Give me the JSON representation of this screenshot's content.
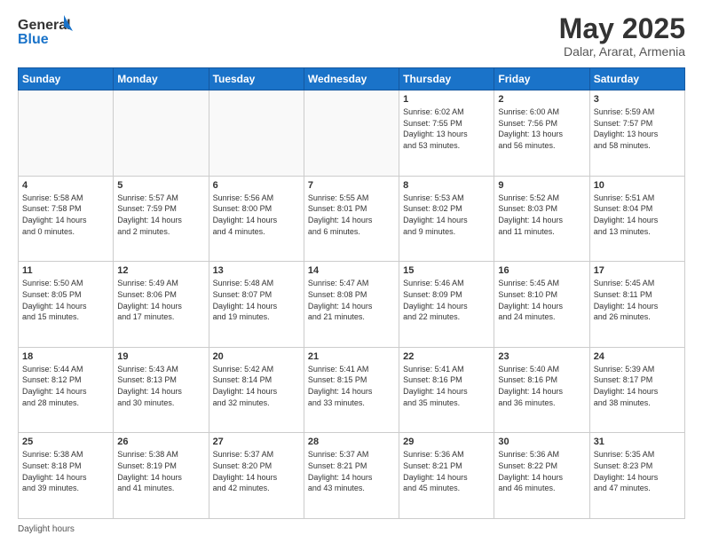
{
  "logo": {
    "line1": "General",
    "line2": "Blue"
  },
  "title": "May 2025",
  "subtitle": "Dalar, Ararat, Armenia",
  "days_header": [
    "Sunday",
    "Monday",
    "Tuesday",
    "Wednesday",
    "Thursday",
    "Friday",
    "Saturday"
  ],
  "weeks": [
    [
      {
        "day": "",
        "info": ""
      },
      {
        "day": "",
        "info": ""
      },
      {
        "day": "",
        "info": ""
      },
      {
        "day": "",
        "info": ""
      },
      {
        "day": "1",
        "info": "Sunrise: 6:02 AM\nSunset: 7:55 PM\nDaylight: 13 hours\nand 53 minutes."
      },
      {
        "day": "2",
        "info": "Sunrise: 6:00 AM\nSunset: 7:56 PM\nDaylight: 13 hours\nand 56 minutes."
      },
      {
        "day": "3",
        "info": "Sunrise: 5:59 AM\nSunset: 7:57 PM\nDaylight: 13 hours\nand 58 minutes."
      }
    ],
    [
      {
        "day": "4",
        "info": "Sunrise: 5:58 AM\nSunset: 7:58 PM\nDaylight: 14 hours\nand 0 minutes."
      },
      {
        "day": "5",
        "info": "Sunrise: 5:57 AM\nSunset: 7:59 PM\nDaylight: 14 hours\nand 2 minutes."
      },
      {
        "day": "6",
        "info": "Sunrise: 5:56 AM\nSunset: 8:00 PM\nDaylight: 14 hours\nand 4 minutes."
      },
      {
        "day": "7",
        "info": "Sunrise: 5:55 AM\nSunset: 8:01 PM\nDaylight: 14 hours\nand 6 minutes."
      },
      {
        "day": "8",
        "info": "Sunrise: 5:53 AM\nSunset: 8:02 PM\nDaylight: 14 hours\nand 9 minutes."
      },
      {
        "day": "9",
        "info": "Sunrise: 5:52 AM\nSunset: 8:03 PM\nDaylight: 14 hours\nand 11 minutes."
      },
      {
        "day": "10",
        "info": "Sunrise: 5:51 AM\nSunset: 8:04 PM\nDaylight: 14 hours\nand 13 minutes."
      }
    ],
    [
      {
        "day": "11",
        "info": "Sunrise: 5:50 AM\nSunset: 8:05 PM\nDaylight: 14 hours\nand 15 minutes."
      },
      {
        "day": "12",
        "info": "Sunrise: 5:49 AM\nSunset: 8:06 PM\nDaylight: 14 hours\nand 17 minutes."
      },
      {
        "day": "13",
        "info": "Sunrise: 5:48 AM\nSunset: 8:07 PM\nDaylight: 14 hours\nand 19 minutes."
      },
      {
        "day": "14",
        "info": "Sunrise: 5:47 AM\nSunset: 8:08 PM\nDaylight: 14 hours\nand 21 minutes."
      },
      {
        "day": "15",
        "info": "Sunrise: 5:46 AM\nSunset: 8:09 PM\nDaylight: 14 hours\nand 22 minutes."
      },
      {
        "day": "16",
        "info": "Sunrise: 5:45 AM\nSunset: 8:10 PM\nDaylight: 14 hours\nand 24 minutes."
      },
      {
        "day": "17",
        "info": "Sunrise: 5:45 AM\nSunset: 8:11 PM\nDaylight: 14 hours\nand 26 minutes."
      }
    ],
    [
      {
        "day": "18",
        "info": "Sunrise: 5:44 AM\nSunset: 8:12 PM\nDaylight: 14 hours\nand 28 minutes."
      },
      {
        "day": "19",
        "info": "Sunrise: 5:43 AM\nSunset: 8:13 PM\nDaylight: 14 hours\nand 30 minutes."
      },
      {
        "day": "20",
        "info": "Sunrise: 5:42 AM\nSunset: 8:14 PM\nDaylight: 14 hours\nand 32 minutes."
      },
      {
        "day": "21",
        "info": "Sunrise: 5:41 AM\nSunset: 8:15 PM\nDaylight: 14 hours\nand 33 minutes."
      },
      {
        "day": "22",
        "info": "Sunrise: 5:41 AM\nSunset: 8:16 PM\nDaylight: 14 hours\nand 35 minutes."
      },
      {
        "day": "23",
        "info": "Sunrise: 5:40 AM\nSunset: 8:16 PM\nDaylight: 14 hours\nand 36 minutes."
      },
      {
        "day": "24",
        "info": "Sunrise: 5:39 AM\nSunset: 8:17 PM\nDaylight: 14 hours\nand 38 minutes."
      }
    ],
    [
      {
        "day": "25",
        "info": "Sunrise: 5:38 AM\nSunset: 8:18 PM\nDaylight: 14 hours\nand 39 minutes."
      },
      {
        "day": "26",
        "info": "Sunrise: 5:38 AM\nSunset: 8:19 PM\nDaylight: 14 hours\nand 41 minutes."
      },
      {
        "day": "27",
        "info": "Sunrise: 5:37 AM\nSunset: 8:20 PM\nDaylight: 14 hours\nand 42 minutes."
      },
      {
        "day": "28",
        "info": "Sunrise: 5:37 AM\nSunset: 8:21 PM\nDaylight: 14 hours\nand 43 minutes."
      },
      {
        "day": "29",
        "info": "Sunrise: 5:36 AM\nSunset: 8:21 PM\nDaylight: 14 hours\nand 45 minutes."
      },
      {
        "day": "30",
        "info": "Sunrise: 5:36 AM\nSunset: 8:22 PM\nDaylight: 14 hours\nand 46 minutes."
      },
      {
        "day": "31",
        "info": "Sunrise: 5:35 AM\nSunset: 8:23 PM\nDaylight: 14 hours\nand 47 minutes."
      }
    ]
  ],
  "footer": "Daylight hours"
}
